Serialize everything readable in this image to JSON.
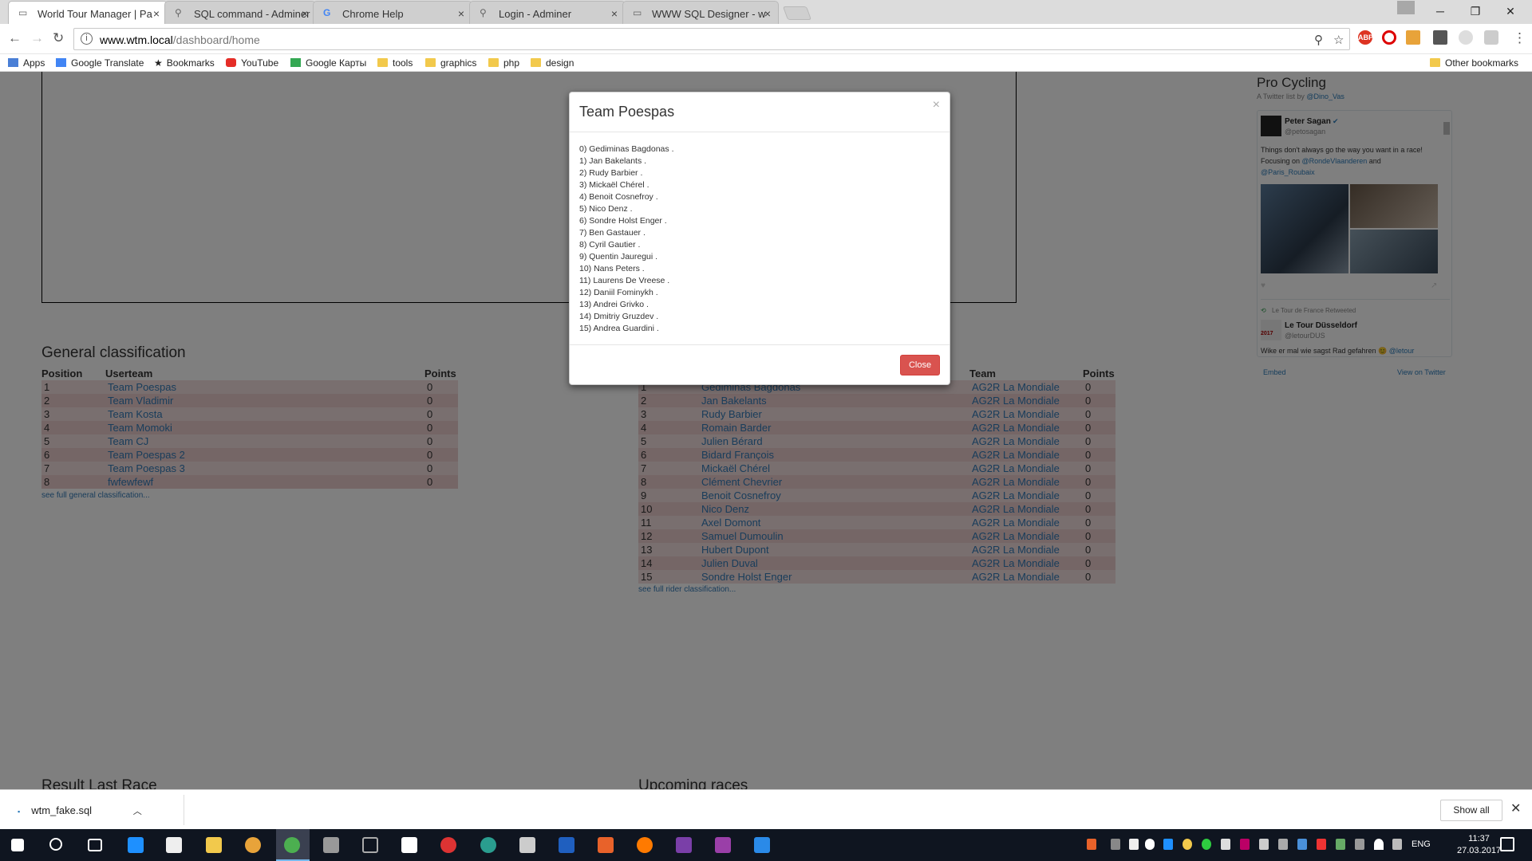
{
  "browser": {
    "tabs": [
      {
        "label": "World Tour Manager | Pa",
        "active": true
      },
      {
        "label": "SQL command - Adminer",
        "active": false
      },
      {
        "label": "Chrome Help",
        "active": false
      },
      {
        "label": "Login - Adminer",
        "active": false
      },
      {
        "label": "WWW SQL Designer - w",
        "active": false
      }
    ],
    "url_host": "www.wtm.local",
    "url_path": "/dashboard/home",
    "bookmarks": [
      "Apps",
      "Google Translate",
      "Bookmarks",
      "YouTube",
      "Google Карты",
      "tools",
      "graphics",
      "php",
      "design"
    ],
    "other_bookmarks": "Other bookmarks",
    "ext_abp": "ABP"
  },
  "general_classification": {
    "title": "General classification",
    "headers": [
      "Position",
      "Userteam",
      "Points"
    ],
    "rows": [
      [
        "1",
        "Team Poespas",
        "0"
      ],
      [
        "2",
        "Team Vladimir",
        "0"
      ],
      [
        "3",
        "Team Kosta",
        "0"
      ],
      [
        "4",
        "Team Momoki",
        "0"
      ],
      [
        "5",
        "Team CJ",
        "0"
      ],
      [
        "6",
        "Team Poespas 2",
        "0"
      ],
      [
        "7",
        "Team Poespas 3",
        "0"
      ],
      [
        "8",
        "fwfewfewf",
        "0"
      ]
    ],
    "see_all": "see full general classification..."
  },
  "rider_classification": {
    "headers": [
      "",
      "",
      "Team",
      "Points"
    ],
    "rows": [
      [
        "1",
        "Gediminas Bagdonas",
        "AG2R La Mondiale",
        "0"
      ],
      [
        "2",
        "Jan Bakelants",
        "AG2R La Mondiale",
        "0"
      ],
      [
        "3",
        "Rudy Barbier",
        "AG2R La Mondiale",
        "0"
      ],
      [
        "4",
        "Romain Barder",
        "AG2R La Mondiale",
        "0"
      ],
      [
        "5",
        "Julien Bérard",
        "AG2R La Mondiale",
        "0"
      ],
      [
        "6",
        "Bidard François",
        "AG2R La Mondiale",
        "0"
      ],
      [
        "7",
        "Mickaël Chérel",
        "AG2R La Mondiale",
        "0"
      ],
      [
        "8",
        "Clément Chevrier",
        "AG2R La Mondiale",
        "0"
      ],
      [
        "9",
        "Benoit Cosnefroy",
        "AG2R La Mondiale",
        "0"
      ],
      [
        "10",
        "Nico Denz",
        "AG2R La Mondiale",
        "0"
      ],
      [
        "11",
        "Axel Domont",
        "AG2R La Mondiale",
        "0"
      ],
      [
        "12",
        "Samuel Dumoulin",
        "AG2R La Mondiale",
        "0"
      ],
      [
        "13",
        "Hubert Dupont",
        "AG2R La Mondiale",
        "0"
      ],
      [
        "14",
        "Julien Duval",
        "AG2R La Mondiale",
        "0"
      ],
      [
        "15",
        "Sondre Holst Enger",
        "AG2R La Mondiale",
        "0"
      ]
    ],
    "see_all": "see full rider classification..."
  },
  "bottom_sections": {
    "left": "Result Last Race",
    "right": "Upcoming races"
  },
  "twitter": {
    "title": "Pro Cycling",
    "subtitle_prefix": "A Twitter list by ",
    "subtitle_handle": "@Dino_Vas",
    "tweet1_name": "Peter Sagan",
    "tweet1_handle": "@petosagan",
    "tweet1_text1": "Things don't always go the way you want in a race!",
    "tweet1_text2": "Focusing on ",
    "tweet1_link1": "@RondeVlaanderen",
    "tweet1_text3": " and",
    "tweet1_link2": "@Paris_Roubaix",
    "retweet_label": "Le Tour de France Retweeted",
    "tweet2_name": "Le Tour Düsseldorf",
    "tweet2_handle": "@letourDUS",
    "tweet2_avatar_text": "2017",
    "tweet2_text": "Wike er mal wie sagst Rad gefahren 😊 ",
    "tweet2_link": "@letour",
    "embed": "Embed",
    "view_on_twitter": "View on Twitter"
  },
  "modal": {
    "title": "Team Poespas",
    "close_x": "×",
    "riders": [
      "0) Gediminas Bagdonas .",
      "1) Jan Bakelants .",
      "2) Rudy Barbier .",
      "3) Mickaël Chérel .",
      "4) Benoit Cosnefroy .",
      "5) Nico Denz .",
      "6) Sondre Holst Enger .",
      "7) Ben Gastauer .",
      "8) Cyril Gautier .",
      "9) Quentin Jauregui .",
      "10) Nans Peters .",
      "11) Laurens De Vreese .",
      "12) Daniil Fominykh .",
      "13) Andrei Grivko .",
      "14) Dmitriy Gruzdev .",
      "15) Andrea Guardini ."
    ],
    "close_button": "Close"
  },
  "download_bar": {
    "file": "wtm_fake.sql",
    "show_all": "Show all"
  },
  "taskbar": {
    "time": "11:37",
    "date": "27.03.2017",
    "language": "ENG"
  }
}
